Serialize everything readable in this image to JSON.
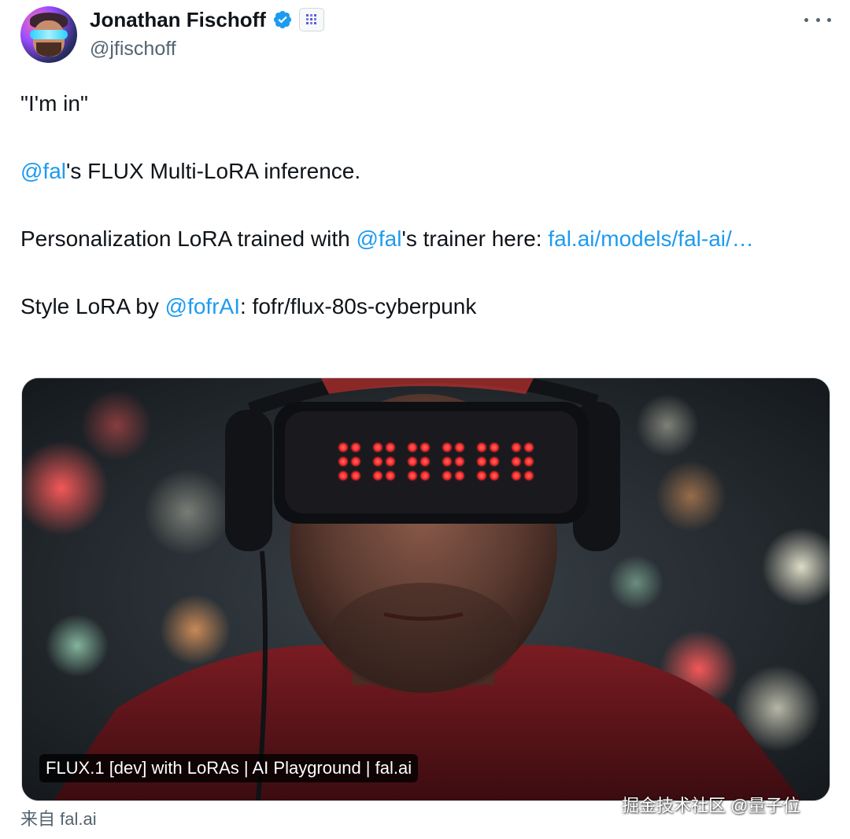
{
  "author": {
    "display_name": "Jonathan Fischoff",
    "handle": "@jfischoff",
    "verified": true
  },
  "tweet": {
    "line1": "\"I'm in\"",
    "line2_mention": "@fal",
    "line2_rest": "'s FLUX Multi-LoRA inference.",
    "line3_prefix": "Personalization LoRA trained with ",
    "line3_mention": "@fal",
    "line3_middle": "'s trainer here: ",
    "line3_link": "fal.ai/models/fal-ai/…",
    "line4_prefix": "Style LoRA by ",
    "line4_mention": "@fofrAI",
    "line4_rest": ": fofr/flux-80s-cyberpunk"
  },
  "media": {
    "caption": "FLUX.1 [dev] with LoRAs | AI Playground | fal.ai"
  },
  "source": {
    "label": "来自 fal.ai"
  },
  "watermark": {
    "text": "掘金技术社区 @量子位"
  },
  "colors": {
    "link": "#1d9bf0",
    "verified": "#1d9bf0",
    "secondary_text": "#536471",
    "led": "#ff3b3b"
  },
  "icons": {
    "verified": "verified-badge-icon",
    "affiliate": "affiliate-badge-icon",
    "more": "more-horizontal-icon"
  }
}
